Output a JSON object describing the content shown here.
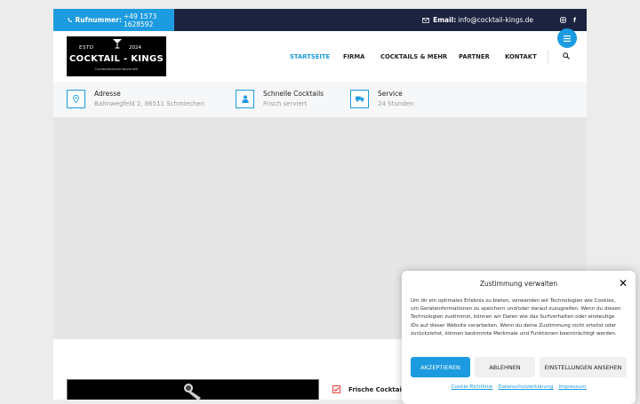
{
  "topbar": {
    "phone_label": "Rufnummer:",
    "phone_value": "+49 1573 1628592",
    "email_label": "Email:",
    "email_value": "info@cocktail-kings.de",
    "social_icons": [
      "instagram-icon",
      "facebook-icon"
    ]
  },
  "logo": {
    "estd": "ESTD",
    "year": "2024",
    "name": "COCKTAIL - KINGS",
    "subtitle": "Cocktailmaschinenverleih"
  },
  "nav": {
    "items": [
      "STARTSEITE",
      "FIRMA",
      "COCKTAILS & MEHR",
      "PARTNER",
      "KONTAKT"
    ],
    "active": "STARTSEITE"
  },
  "info": [
    {
      "icon": "map-pin-icon",
      "title": "Adresse",
      "value": "Bahnwegfeld 2, 86511 Schmiechen"
    },
    {
      "icon": "user-icon",
      "title": "Schnelle Cocktails",
      "value": "Frisch serviert"
    },
    {
      "icon": "truck-icon",
      "title": "Service",
      "value": "24 Stunden"
    }
  ],
  "lower": {
    "feature_label": "Frische Cocktails"
  },
  "consent": {
    "title": "Zustimmung verwalten",
    "body": "Um dir ein optimales Erlebnis zu bieten, verwenden wir Technologien wie Cookies, um Geräteinformationen zu speichern und/oder darauf zuzugreifen. Wenn du diesen Technologien zustimmst, können wir Daten wie das Surfverhalten oder eindeutige IDs auf dieser Website verarbeiten. Wenn du deine Zustimmung nicht erteilst oder zurückziehst, können bestimmte Merkmale und Funktionen beeinträchtigt werden.",
    "accept": "AKZEPTIEREN",
    "deny": "ABLEHNEN",
    "settings": "EINSTELLUNGEN ANSEHEN",
    "links": [
      "Cookie-Richtlinie",
      "Datenschutzerklärung",
      "Impressum"
    ]
  },
  "colors": {
    "accent": "#1d9be0",
    "topbar": "#1c2340",
    "hero_bg": "#e6e6e6"
  }
}
